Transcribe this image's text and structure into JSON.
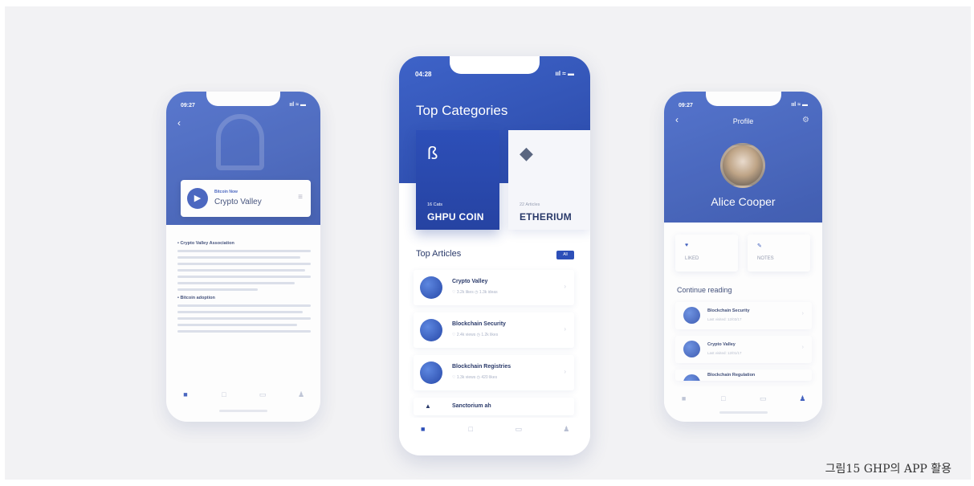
{
  "caption": "그림15 GHP의 APP 활용",
  "left_phone": {
    "status_time": "09:27",
    "status_icons": "ııl ≈ ▬",
    "back": "‹",
    "player": {
      "kicker": "Bitcoin Now",
      "title": "Crypto Valley",
      "play": "▶",
      "menu": "≡"
    },
    "sections": [
      {
        "heading": "• Crypto Valley Association",
        "lines": 7
      },
      {
        "heading": "• Bitcoin adoption",
        "lines": 7
      }
    ],
    "tabs": [
      "■",
      "□",
      "▭",
      "♟"
    ]
  },
  "center_phone": {
    "status_time": "04:28",
    "status_icons": "ııl ≈ ▬",
    "heading": "Top Categories",
    "categories": [
      {
        "icon": "ß",
        "count": "16 Cats",
        "name": "GHPU COIN"
      },
      {
        "icon": "◆",
        "count": "22 Articles",
        "name": "ETHERIUM"
      }
    ],
    "articles_heading": "Top Articles",
    "all_label": "All",
    "articles": [
      {
        "title": "Crypto Valley",
        "meta": "♡ 3.2k likes   ◷ 1.3k ideas"
      },
      {
        "title": "Blockchain Security",
        "meta": "♡ 2.4k views   ◷ 1.2k likes"
      },
      {
        "title": "Blockchain Registries",
        "meta": "♡ 1.3k views   ◷ 420 likes"
      },
      {
        "title": "Sanctorium ah",
        "meta": ""
      }
    ],
    "tabs": [
      "■",
      "□",
      "▭",
      "♟"
    ]
  },
  "right_phone": {
    "status_time": "09:27",
    "status_icons": "ııl ≈ ▬",
    "back": "‹",
    "title": "Profile",
    "gear": "⚙",
    "name": "Alice Cooper",
    "stats": [
      {
        "icon": "♥",
        "label": "LIKED"
      },
      {
        "icon": "✎",
        "label": "NOTES"
      }
    ],
    "continue_heading": "Continue reading",
    "reading": [
      {
        "title": "Blockchain Security",
        "sub": "Last visited: 12/03/17"
      },
      {
        "title": "Crypto Valley",
        "sub": "Last visited: 12/01/17"
      },
      {
        "title": "Blockchain Regulation",
        "sub": ""
      }
    ],
    "tabs": [
      "■",
      "□",
      "▭",
      "♟"
    ]
  }
}
